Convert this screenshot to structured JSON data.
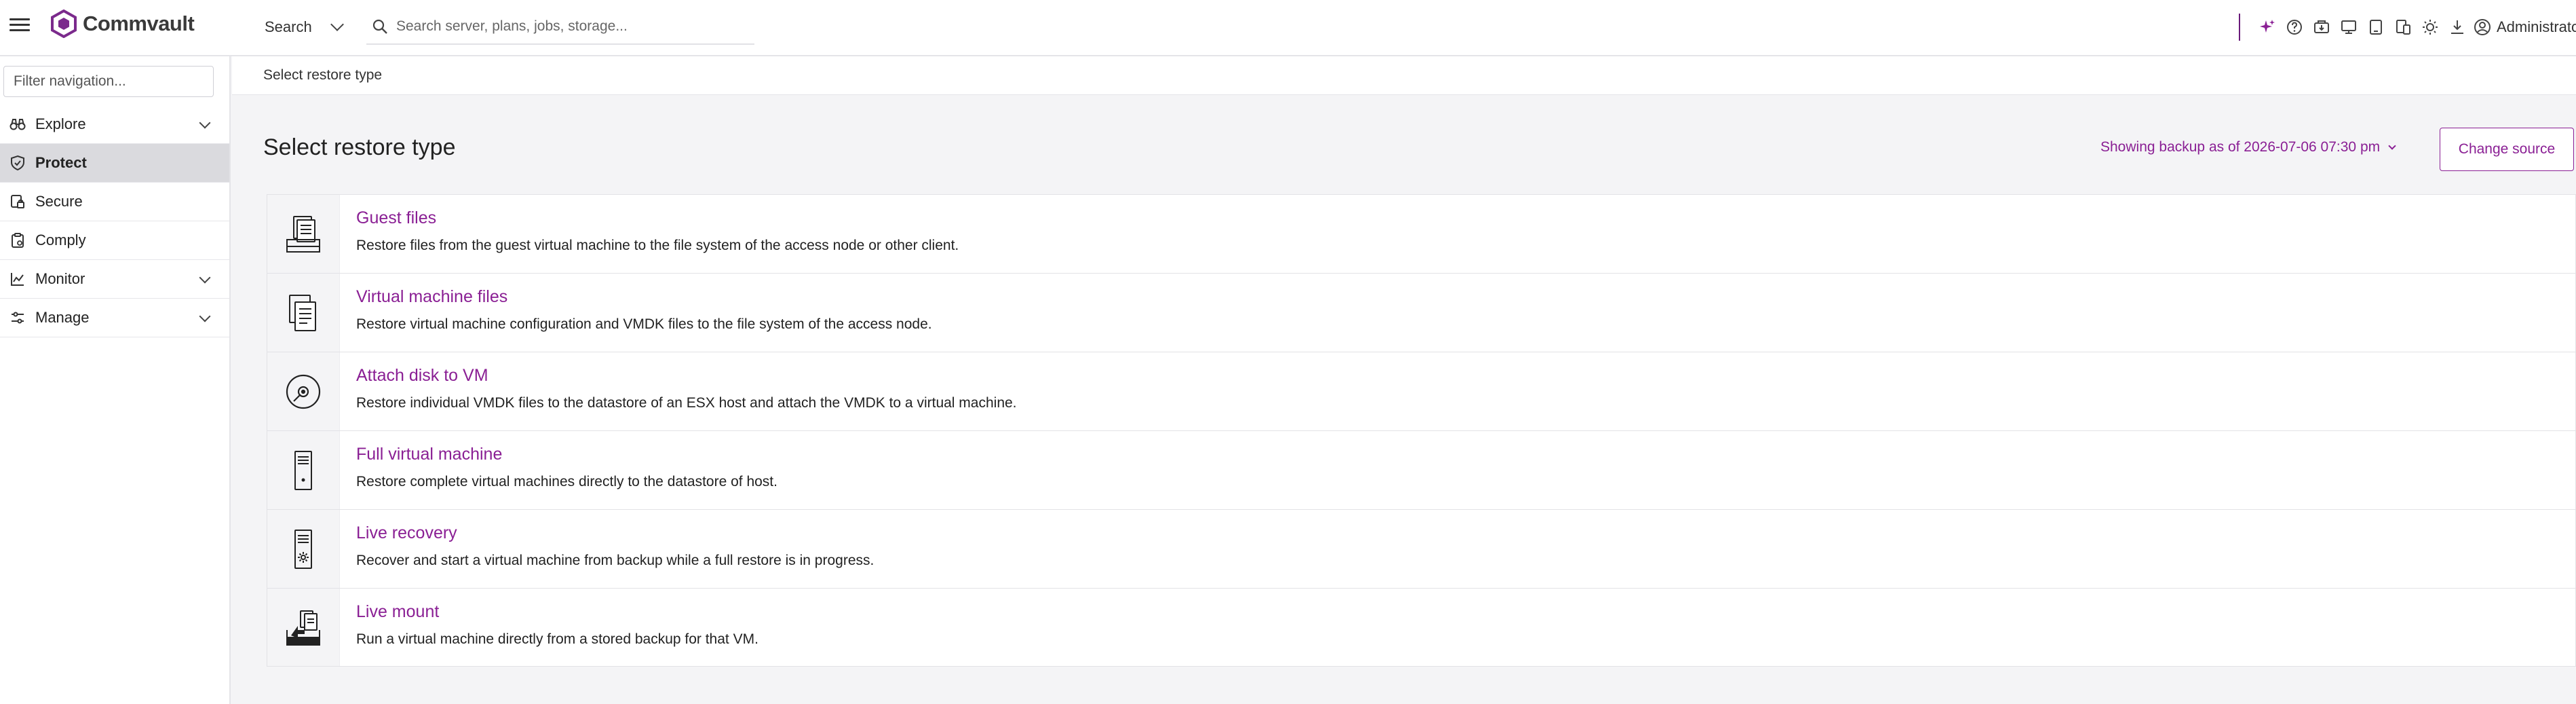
{
  "header": {
    "brand": "Commvault",
    "search_scope": "Search",
    "search_placeholder": "Search server, plans, jobs, storage...",
    "user": "Administrator",
    "tools": [
      "ai-sparkle-icon",
      "help-icon",
      "downloads-center-icon",
      "monitor-icon",
      "tablet-icon",
      "devices-icon",
      "theme-icon",
      "download-icon"
    ],
    "accent_color": "#8a1f94"
  },
  "sidebar": {
    "filter_placeholder": "Filter navigation...",
    "items": [
      {
        "label": "Explore",
        "icon": "binoculars-icon",
        "expandable": true,
        "active": false
      },
      {
        "label": "Protect",
        "icon": "shield-check-icon",
        "expandable": false,
        "active": true
      },
      {
        "label": "Secure",
        "icon": "lock-shield-icon",
        "expandable": false,
        "active": false
      },
      {
        "label": "Comply",
        "icon": "clipboard-icon",
        "expandable": false,
        "active": false
      },
      {
        "label": "Monitor",
        "icon": "chart-line-icon",
        "expandable": true,
        "active": false
      },
      {
        "label": "Manage",
        "icon": "sliders-icon",
        "expandable": true,
        "active": false
      }
    ]
  },
  "main": {
    "breadcrumb": "Select restore type",
    "title": "Select restore type",
    "backup_as_of": "Showing backup as of 2026-07-06 07:30 pm",
    "change_source_label": "Change source",
    "restore_types": [
      {
        "title": "Guest files",
        "description": "Restore files from the guest virtual machine to the file system of the access node or other client.",
        "icon": "guest-files-icon"
      },
      {
        "title": "Virtual machine files",
        "description": "Restore virtual machine configuration and VMDK files to the file system of the access node.",
        "icon": "vm-files-icon"
      },
      {
        "title": "Attach disk to VM",
        "description": "Restore individual VMDK files to the datastore of an ESX host and attach the VMDK to a virtual machine.",
        "icon": "disk-icon"
      },
      {
        "title": "Full virtual machine",
        "description": "Restore complete virtual machines directly to the datastore of host.",
        "icon": "server-icon"
      },
      {
        "title": "Live recovery",
        "description": "Recover and start a virtual machine from backup while a full restore is in progress.",
        "icon": "live-recovery-icon"
      },
      {
        "title": "Live mount",
        "description": "Run a virtual machine directly from a stored backup for that VM.",
        "icon": "live-mount-icon"
      }
    ]
  }
}
